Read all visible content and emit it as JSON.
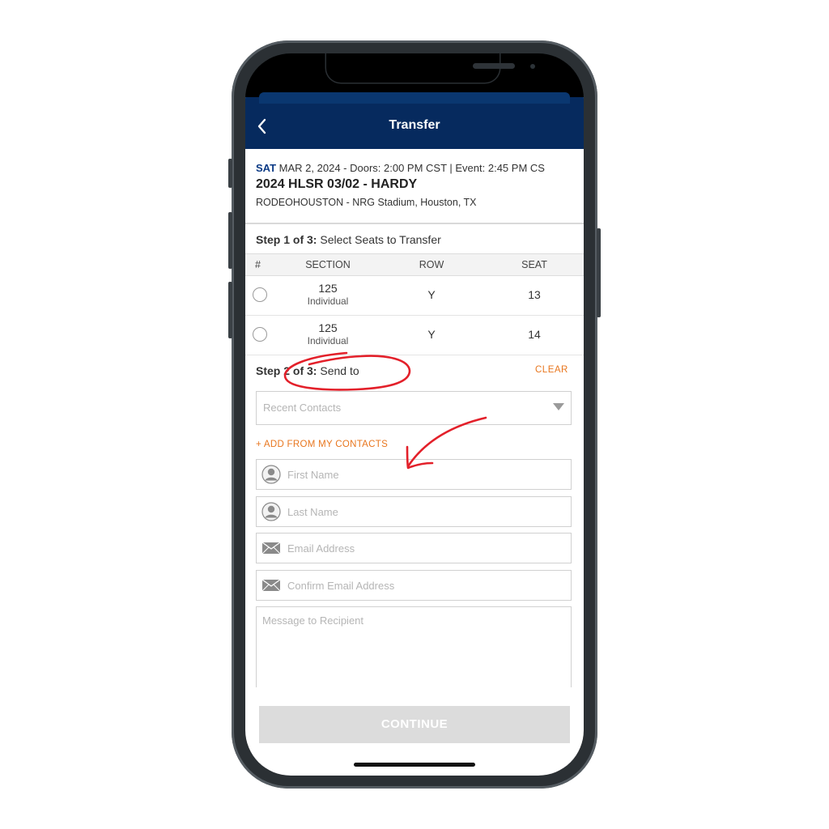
{
  "header": {
    "title": "Transfer"
  },
  "event": {
    "day": "SAT",
    "details": "MAR 2, 2024 - Doors: 2:00 PM CST | Event: 2:45 PM CS",
    "title": "2024 HLSR 03/02 - HARDY",
    "venue": "RODEOHOUSTON - NRG Stadium, Houston, TX"
  },
  "step1": {
    "label": "Step 1 of 3:",
    "text": "Select Seats to Transfer"
  },
  "table": {
    "headers": [
      "#",
      "SECTION",
      "ROW",
      "SEAT"
    ],
    "rows": [
      {
        "section": "125",
        "type": "Individual",
        "row": "Y",
        "seat": "13"
      },
      {
        "section": "125",
        "type": "Individual",
        "row": "Y",
        "seat": "14"
      }
    ]
  },
  "step2": {
    "label": "Step 2 of 3:",
    "text": "Send to",
    "clear": "CLEAR"
  },
  "form": {
    "recent_contacts_placeholder": "Recent Contacts",
    "add_contacts": "+ ADD FROM MY CONTACTS",
    "first_name_placeholder": "First Name",
    "last_name_placeholder": "Last Name",
    "email_placeholder": "Email Address",
    "confirm_email_placeholder": "Confirm Email Address",
    "message_placeholder": "Message to Recipient"
  },
  "footer": {
    "continue": "CONTINUE"
  },
  "colors": {
    "header": "#062a5e",
    "accent": "#e8761e",
    "day": "#0b3a85",
    "annotation": "#e3202a"
  }
}
